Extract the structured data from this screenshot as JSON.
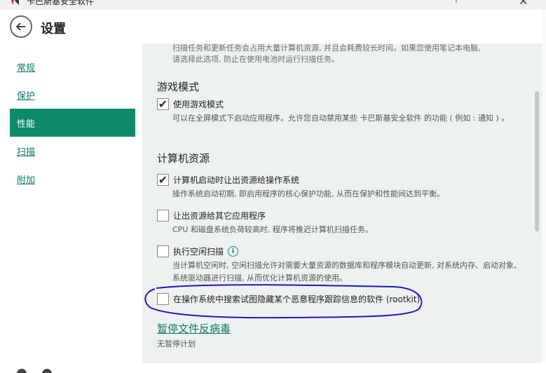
{
  "window": {
    "title": "卡巴斯基安全软件",
    "help_icon": "question-mark-icon",
    "minimize_icon": "minimize-icon",
    "close_icon": "close-icon"
  },
  "header": {
    "title": "设置",
    "back_icon": "back-arrow-icon"
  },
  "sidebar": {
    "items": [
      {
        "label": "常规",
        "active": false
      },
      {
        "label": "保护",
        "active": false
      },
      {
        "label": "性能",
        "active": true
      },
      {
        "label": "扫描",
        "active": false
      },
      {
        "label": "附加",
        "active": false
      }
    ]
  },
  "content": {
    "partial_text_1": "扫描任务和更新任务会占用大量计算机资源, 并且会耗费较长时间。如果您使用笔记本电脑,",
    "partial_text_2": "请选择此选项, 防止在使用电池时运行扫描任务。",
    "game_section": {
      "title": "游戏模式",
      "option": {
        "label": "使用游戏模式",
        "checked": true
      },
      "desc": "可以在全屏模式下启动应用程序。允许您自动禁用某些 卡巴斯基安全软件 的功能 ( 例如 : 通知 ) 。"
    },
    "resources_section": {
      "title": "计算机资源",
      "options": [
        {
          "label": "计算机启动时让出资源给操作系统",
          "checked": true,
          "desc": "操作系统启动初期, 即启用程序的核心保护功能, 从而在保护和性能间达到平衡。"
        },
        {
          "label": "让出资源给其它应用程序",
          "checked": false,
          "desc": "CPU 和磁盘系统负荷较高时, 程序将推迟计算机扫描任务。"
        },
        {
          "label": "执行空闲扫描",
          "checked": false,
          "desc": "当计算机空闲时, 空闲扫描允许对需要大量资源的数据库和程序模块自动更新, 对系统内存、启动对象、系统驱动器进行扫描, 从而优化计算机资源的使用。"
        },
        {
          "label": "在操作系统中搜索试图隐藏某个恶意程序跟踪信息的软件 (rootkit)",
          "checked": false
        }
      ]
    },
    "pause_link": "暂停文件反病毒",
    "pause_sub": "无暂停计划"
  },
  "colors": {
    "accent": "#0e8a6a",
    "annotation": "#1a1ab8"
  }
}
